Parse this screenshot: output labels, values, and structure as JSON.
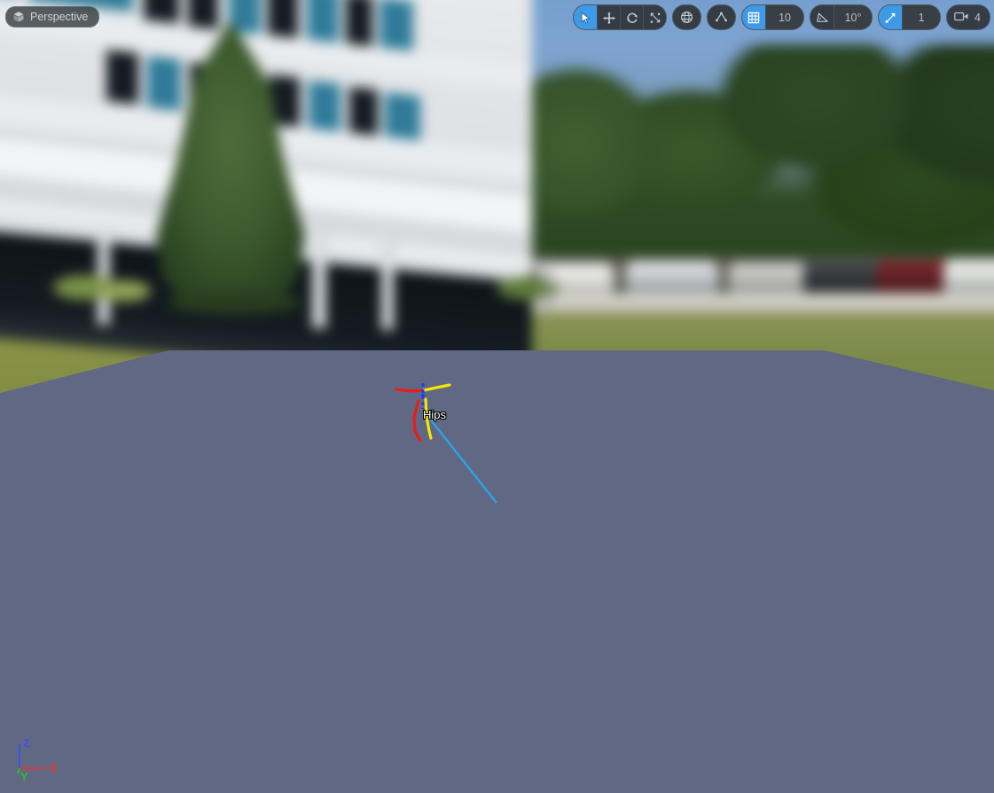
{
  "viewport": {
    "type_label": "Perspective",
    "type_icon": "cube-icon"
  },
  "toolbar": {
    "transform_tools": [
      {
        "name": "select-tool",
        "icon": "cursor-icon",
        "active": true,
        "tooltip": "Select"
      },
      {
        "name": "translate-tool",
        "icon": "move-arrows-icon",
        "active": false,
        "tooltip": "Translate"
      },
      {
        "name": "rotate-tool",
        "icon": "rotate-arrows-icon",
        "active": false,
        "tooltip": "Rotate"
      },
      {
        "name": "scale-tool",
        "icon": "scale-arrows-icon",
        "active": false,
        "tooltip": "Scale"
      }
    ],
    "coordinate_system": {
      "name": "world-space-toggle",
      "icon": "globe-icon"
    },
    "surface_snap": {
      "name": "surface-snapping-toggle",
      "icon": "surface-snap-icon"
    },
    "grid_snap": {
      "name": "grid-snap-toggle",
      "icon": "grid-icon",
      "active": true,
      "value": "10"
    },
    "angle_snap": {
      "name": "angle-snap-toggle",
      "icon": "angle-icon",
      "active": false,
      "value": "10°"
    },
    "scale_snap": {
      "name": "scale-snap-toggle",
      "icon": "scale-snap-icon",
      "active": true,
      "value": "1"
    },
    "camera_speed": {
      "name": "camera-speed",
      "icon": "camera-icon",
      "value": "4"
    }
  },
  "scene": {
    "selected_bone_label": "Hips",
    "axis_gizmo": {
      "x_label": "X",
      "y_label": "Y",
      "z_label": "Z"
    }
  },
  "colors": {
    "accent_blue": "#3d9ae8",
    "ground_plane": "#616883",
    "sky": "#8cabd4",
    "selection_line": "#29a5e8",
    "bone_red": "#e81d1d",
    "bone_yellow": "#f2e800",
    "bone_blue": "#1f3df0",
    "axis_x": "#e03434",
    "axis_y": "#27c127",
    "axis_z": "#3a52e8"
  }
}
